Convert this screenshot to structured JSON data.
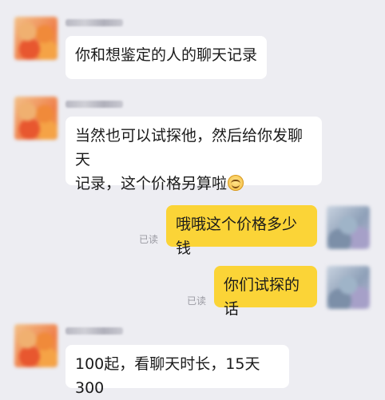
{
  "messages": [
    {
      "side": "left",
      "text": "你和想鉴定的人的聊天记录"
    },
    {
      "side": "left",
      "line1": "当然也可以试探他，然后给你发聊天",
      "line2": "记录，这个价格另算啦",
      "emoji": "smile-emoji"
    },
    {
      "side": "right",
      "text": "哦哦这个价格多少钱",
      "status": "已读"
    },
    {
      "side": "right",
      "text": "你们试探的话",
      "status": "已读"
    },
    {
      "side": "left",
      "text": "100起，看聊天时长，15天300"
    }
  ]
}
